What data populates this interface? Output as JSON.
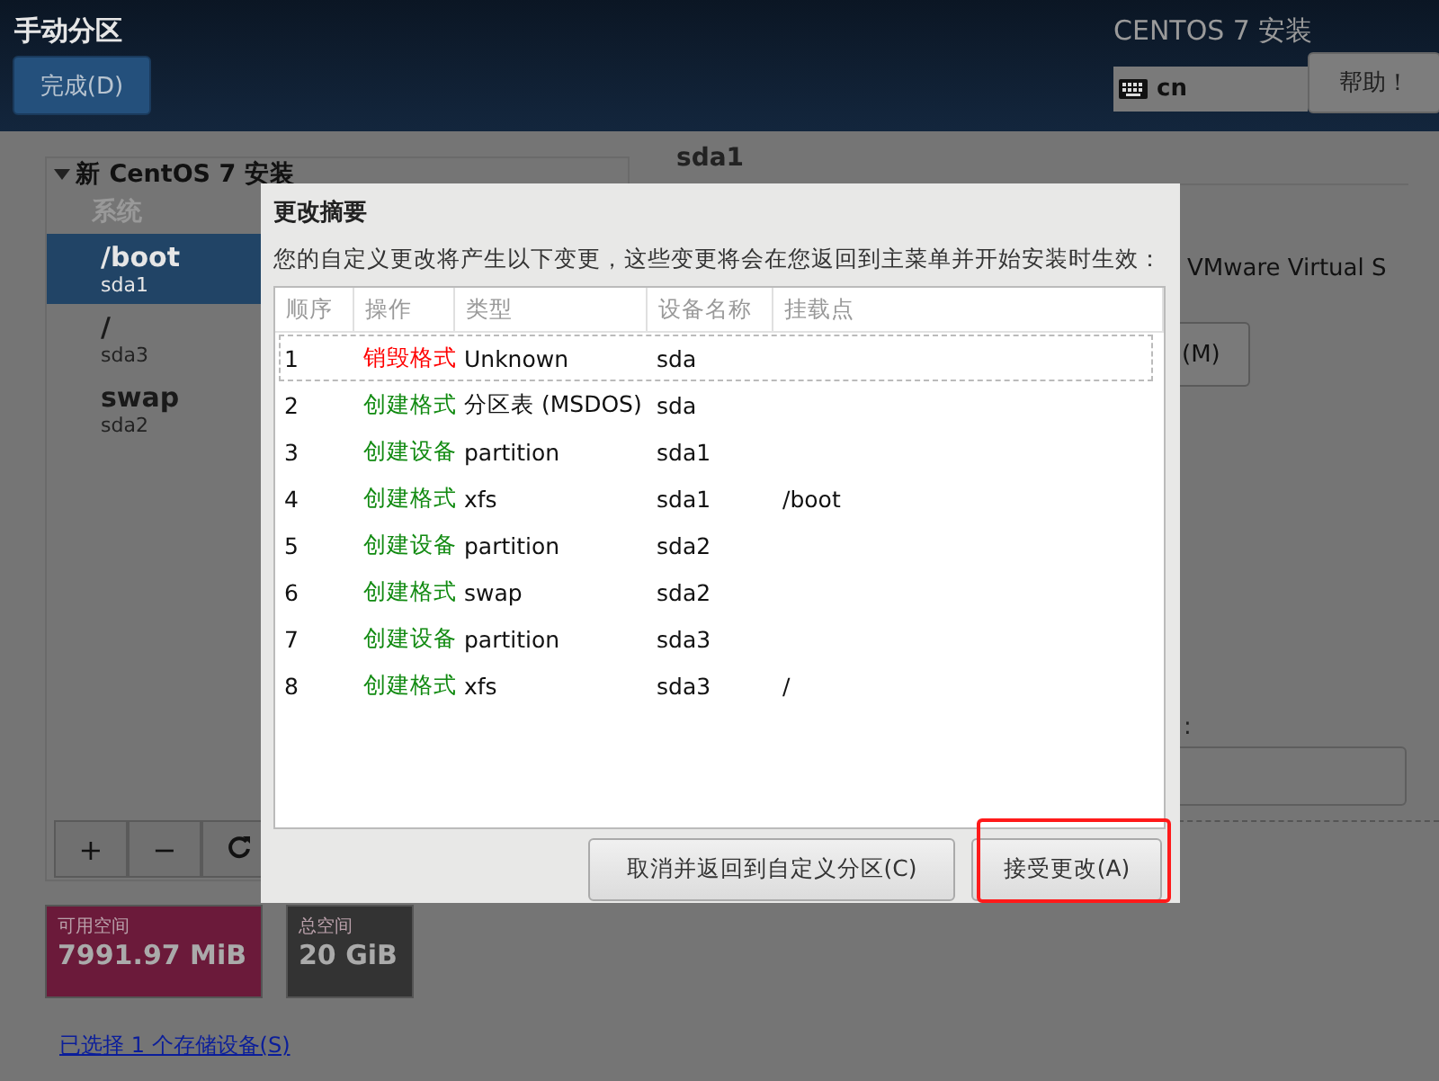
{
  "header": {
    "title": "手动分区",
    "done_button": "完成(D)",
    "product": "CENTOS 7 安装",
    "keyboard_layout": "cn",
    "help_button": "帮助！"
  },
  "partitions": {
    "group": "新 CentOS 7 安装",
    "expanded": true,
    "section": "系统",
    "items": [
      {
        "mount": "/boot",
        "device": "sda1",
        "selected": true
      },
      {
        "mount": "/",
        "device": "sda3",
        "selected": false
      },
      {
        "mount": "swap",
        "device": "sda2",
        "selected": false
      }
    ],
    "toolbar": [
      "+",
      "−"
    ]
  },
  "space": {
    "available_label": "可用空间",
    "available": "7991.97 MiB",
    "total_label": "总空间",
    "total": "20 GiB"
  },
  "storage_link": "已选择 1 个存储设备(S)",
  "details": {
    "device": "sda1",
    "description": "VMware Virtual S",
    "button": "(M)",
    "label": ":"
  },
  "dialog": {
    "title": "更改摘要",
    "message": "您的自定义更改将产生以下变更，这些变更将会在您返回到主菜单并开始安装时生效：",
    "columns": [
      "顺序",
      "操作",
      "类型",
      "设备名称",
      "挂载点"
    ],
    "rows": [
      {
        "order": "1",
        "action": "销毁格式",
        "type": "Unknown",
        "device": "sda",
        "color": "#ff0000",
        "focused": true
      },
      {
        "order": "2",
        "action": "创建格式",
        "type": "分区表 (MSDOS)",
        "device": "sda",
        "color": "#118a11",
        "focused": false
      },
      {
        "order": "3",
        "action": "创建设备",
        "type": "partition",
        "device": "sda1",
        "color": "#118a11",
        "focused": false
      },
      {
        "order": "4",
        "action": "创建格式",
        "type": "xfs",
        "device": "sda1",
        "mount": "/boot",
        "color": "#118a11",
        "focused": false
      },
      {
        "order": "5",
        "action": "创建设备",
        "type": "partition",
        "device": "sda2",
        "color": "#118a11",
        "focused": false
      },
      {
        "order": "6",
        "action": "创建格式",
        "type": "swap",
        "device": "sda2",
        "color": "#118a11",
        "focused": false
      },
      {
        "order": "7",
        "action": "创建设备",
        "type": "partition",
        "device": "sda3",
        "color": "#118a11",
        "focused": false
      },
      {
        "order": "8",
        "action": "创建格式",
        "type": "xfs",
        "device": "sda3",
        "mount": "/",
        "color": "#118a11",
        "focused": false
      }
    ],
    "buttons": [
      {
        "label": "取消并返回到自定义分区(C)",
        "highlighted": false
      },
      {
        "label": "接受更改(A)",
        "highlighted": true
      }
    ]
  }
}
